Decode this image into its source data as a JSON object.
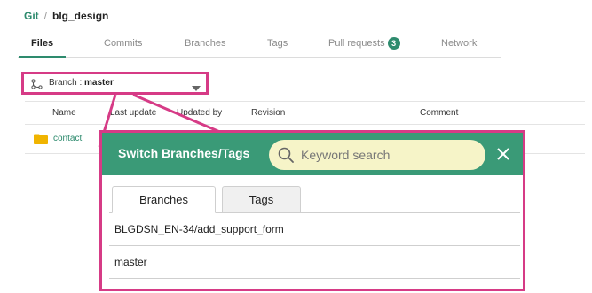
{
  "breadcrumb": {
    "root": "Git",
    "separator": "/",
    "repo": "blg_design"
  },
  "tabs": [
    {
      "label": "Files",
      "active": true
    },
    {
      "label": "Commits",
      "active": false
    },
    {
      "label": "Branches",
      "active": false
    },
    {
      "label": "Tags",
      "active": false
    },
    {
      "label": "Pull requests",
      "active": false,
      "badge": "3"
    },
    {
      "label": "Network",
      "active": false
    }
  ],
  "branch_selector": {
    "prefix": "Branch :",
    "value": "master",
    "icon": "branch-icon",
    "caret_icon": "caret-down-icon"
  },
  "table": {
    "columns": [
      "Name",
      "Last update",
      "Updated by",
      "Revision",
      "Comment"
    ],
    "rows": [
      {
        "name": "contact",
        "icon": "folder-icon"
      }
    ]
  },
  "modal": {
    "title": "Switch Branches/Tags",
    "search_placeholder": "Keyword search",
    "search_icon": "search-icon",
    "close_icon": "close-icon",
    "tabs": [
      {
        "label": "Branches",
        "active": true
      },
      {
        "label": "Tags",
        "active": false
      }
    ],
    "items": [
      "BLGDSN_EN-34/add_support_form",
      "master"
    ]
  },
  "colors": {
    "accent_green": "#2e8b6e",
    "modal_header": "#3a9a77",
    "highlight_pink": "#d63b86",
    "search_bg": "#f6f4c8",
    "folder_yellow": "#f0b400"
  }
}
